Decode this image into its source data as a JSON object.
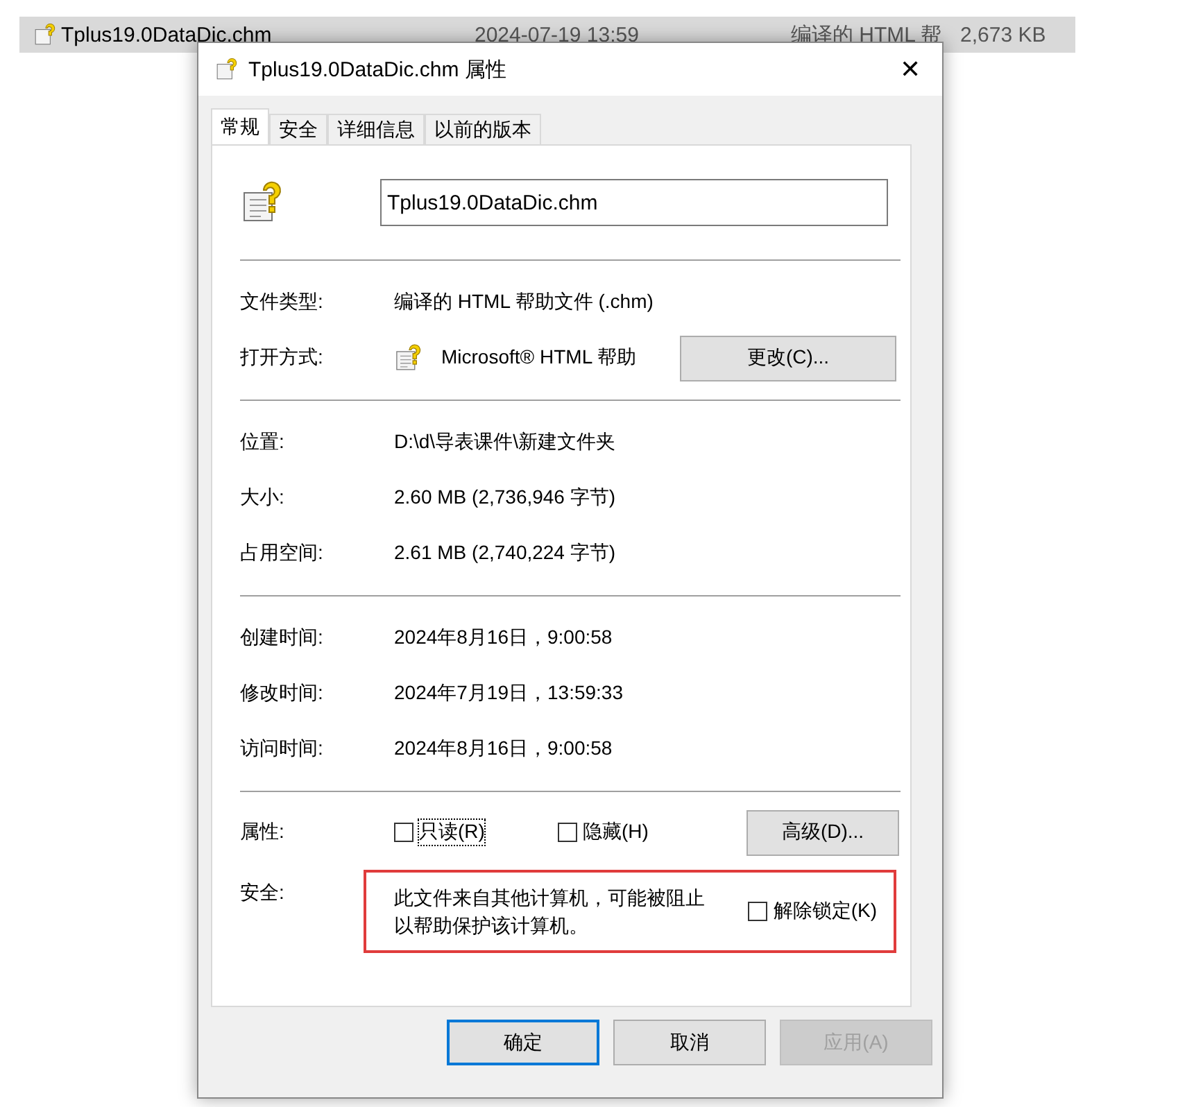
{
  "explorer_row": {
    "name": "Tplus19.0DataDic.chm",
    "modified": "2024-07-19 13:59",
    "type": "编译的 HTML 帮",
    "size": "2,673 KB",
    "selected": true
  },
  "window": {
    "title": "Tplus19.0DataDic.chm 属性",
    "close": "✕"
  },
  "tabs": [
    {
      "label": "常规",
      "selected": true
    },
    {
      "label": "安全",
      "selected": false
    },
    {
      "label": "详细信息",
      "selected": false
    },
    {
      "label": "以前的版本",
      "selected": false
    }
  ],
  "file_name": {
    "value": "Tplus19.0DataDic.chm"
  },
  "file_type": {
    "label": "文件类型:",
    "value": "编译的 HTML 帮助文件 (.chm)"
  },
  "opens_with": {
    "label": "打开方式:",
    "value": "Microsoft® HTML 帮助",
    "button": "更改(C)..."
  },
  "size_group": [
    {
      "label": "位置:",
      "value": "D:\\d\\导表课件\\新建文件夹"
    },
    {
      "label": "大小:",
      "value": "2.60 MB (2,736,946 字节)"
    },
    {
      "label": "占用空间:",
      "value": "2.61 MB (2,740,224 字节)"
    }
  ],
  "time_group": [
    {
      "label": "创建时间:",
      "value": "2024年8月16日，9:00:58"
    },
    {
      "label": "修改时间:",
      "value": "2024年7月19日，13:59:33"
    },
    {
      "label": "访问时间:",
      "value": "2024年8月16日，9:00:58"
    }
  ],
  "attributes": {
    "label": "属性:",
    "checkboxes": [
      {
        "label": "只读(R)",
        "checked": false,
        "focused": true
      },
      {
        "label": "隐藏(H)",
        "checked": false,
        "focused": false
      }
    ],
    "button": "高级(D)..."
  },
  "security": {
    "label": "安全:",
    "message": "此文件来自其他计算机，可能被阻止以帮助保护该计算机。",
    "highlighted": true,
    "checkbox": {
      "label": "解除锁定(K)",
      "checked": false
    }
  },
  "buttons": [
    {
      "label": "确定",
      "default": true,
      "disabled": false
    },
    {
      "label": "取消",
      "default": false,
      "disabled": false
    },
    {
      "label": "应用(A)",
      "default": false,
      "disabled": true
    }
  ]
}
